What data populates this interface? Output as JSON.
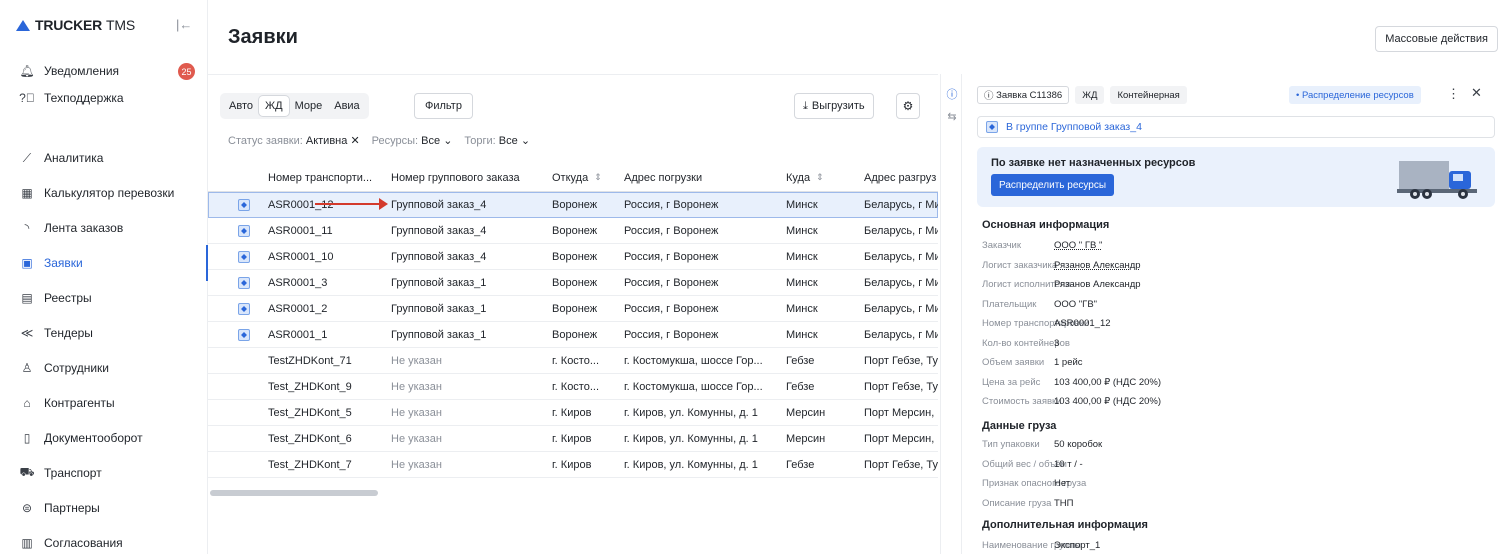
{
  "app": {
    "brand": "TRUCKER",
    "brand_suffix": "TMS"
  },
  "sidebar": {
    "items": [
      {
        "label": "Уведомления",
        "icon": "bell-icon",
        "badge": "25"
      },
      {
        "label": "Техподдержка",
        "icon": "help-icon"
      },
      {
        "label": "Аналитика",
        "icon": "chart-icon"
      },
      {
        "label": "Калькулятор перевозки",
        "icon": "calculator-icon"
      },
      {
        "label": "Лента заказов",
        "icon": "feed-icon"
      },
      {
        "label": "Заявки",
        "icon": "document-icon",
        "active": true
      },
      {
        "label": "Реестры",
        "icon": "registry-icon"
      },
      {
        "label": "Тендеры",
        "icon": "tender-icon"
      },
      {
        "label": "Сотрудники",
        "icon": "user-icon"
      },
      {
        "label": "Контрагенты",
        "icon": "building-icon"
      },
      {
        "label": "Документооборот",
        "icon": "file-icon"
      },
      {
        "label": "Транспорт",
        "icon": "truck-icon"
      },
      {
        "label": "Партнеры",
        "icon": "handshake-icon"
      },
      {
        "label": "Согласования",
        "icon": "approval-icon"
      }
    ]
  },
  "header": {
    "title": "Заявки",
    "mass_actions": "Массовые действия"
  },
  "toolbar": {
    "modes": [
      "Авто",
      "ЖД",
      "Море",
      "Авиа"
    ],
    "active_mode": "ЖД",
    "filter": "Фильтр",
    "export": "Выгрузить"
  },
  "chips": {
    "status_label": "Статус заявки:",
    "status_value": "Активна",
    "resources_label": "Ресурсы:",
    "resources_value": "Все",
    "bids_label": "Торги:",
    "bids_value": "Все"
  },
  "table": {
    "columns": [
      "Номер транспорти...",
      "Номер группового заказа",
      "Откуда",
      "Адрес погрузки",
      "Куда",
      "Адрес разгруз"
    ],
    "rows": [
      {
        "num": "ASR0001_12",
        "group": "Групповой заказ_4",
        "from": "Воронеж",
        "load": "Россия, г Воронеж",
        "to": "Минск",
        "unload": "Беларусь, г Ми",
        "icon": true,
        "selected": true
      },
      {
        "num": "ASR0001_11",
        "group": "Групповой заказ_4",
        "from": "Воронеж",
        "load": "Россия, г Воронеж",
        "to": "Минск",
        "unload": "Беларусь, г Ми",
        "icon": true
      },
      {
        "num": "ASR0001_10",
        "group": "Групповой заказ_4",
        "from": "Воронеж",
        "load": "Россия, г Воронеж",
        "to": "Минск",
        "unload": "Беларусь, г Ми",
        "icon": true
      },
      {
        "num": "ASR0001_3",
        "group": "Групповой заказ_1",
        "from": "Воронеж",
        "load": "Россия, г Воронеж",
        "to": "Минск",
        "unload": "Беларусь, г Ми",
        "icon": true
      },
      {
        "num": "ASR0001_2",
        "group": "Групповой заказ_1",
        "from": "Воронеж",
        "load": "Россия, г Воронеж",
        "to": "Минск",
        "unload": "Беларусь, г Ми",
        "icon": true
      },
      {
        "num": "ASR0001_1",
        "group": "Групповой заказ_1",
        "from": "Воронеж",
        "load": "Россия, г Воронеж",
        "to": "Минск",
        "unload": "Беларусь, г Ми",
        "icon": true
      },
      {
        "num": "TestZHDKont_71",
        "group": "Не указан",
        "from": "г. Косто...",
        "load": "г. Костомукша, шоссе Гор...",
        "to": "Гебзе",
        "unload": "Порт Гебзе, Ту",
        "muted": true
      },
      {
        "num": "Test_ZHDKont_9",
        "group": "Не указан",
        "from": "г. Косто...",
        "load": "г. Костомукша, шоссе Гор...",
        "to": "Гебзе",
        "unload": "Порт Гебзе, Ту",
        "muted": true
      },
      {
        "num": "Test_ZHDKont_5",
        "group": "Не указан",
        "from": "г. Киров",
        "load": "г. Киров, ул. Комунны, д. 1",
        "to": "Мерсин",
        "unload": "Порт Мерсин,",
        "muted": true
      },
      {
        "num": "Test_ZHDKont_6",
        "group": "Не указан",
        "from": "г. Киров",
        "load": "г. Киров, ул. Комунны, д. 1",
        "to": "Мерсин",
        "unload": "Порт Мерсин,",
        "muted": true
      },
      {
        "num": "Test_ZHDKont_7",
        "group": "Не указан",
        "from": "г. Киров",
        "load": "г. Киров, ул. Комунны, д. 1",
        "to": "Гебзе",
        "unload": "Порт Гебзе, Ту",
        "muted": true
      }
    ]
  },
  "panel": {
    "order": "Заявка С11386",
    "type1": "ЖД",
    "type2": "Контейнерная",
    "status": "• Распределение ресурсов",
    "group_link": "В группе Групповой заказ_4",
    "banner_title": "По заявке нет назначенных ресурсов",
    "banner_button": "Распределить ресурсы",
    "main_title": "Основная информация",
    "main": [
      {
        "k": "Заказчик",
        "v": "ООО \" ГВ \""
      },
      {
        "k": "Логист заказчика",
        "v": "Рязанов Александр"
      },
      {
        "k": "Логист исполнителя",
        "v": "Рязанов Александр"
      },
      {
        "k": "Плательщик",
        "v": "ООО \"ГВ\""
      },
      {
        "k": "Номер транспортировки",
        "v": "ASR0001_12"
      },
      {
        "k": "Кол-во контейнеров",
        "v": "3"
      },
      {
        "k": "Объем заявки",
        "v": "1 рейс"
      },
      {
        "k": "Цена за рейс",
        "v": "103 400,00 ₽ (НДС 20%)"
      },
      {
        "k": "Стоимость заявки",
        "v": "103 400,00 ₽ (НДС 20%)"
      }
    ],
    "cargo_title": "Данные груза",
    "cargo": [
      {
        "k": "Тип упаковки",
        "v": "50 коробок"
      },
      {
        "k": "Общий вес / объём",
        "v": "10 т / -"
      },
      {
        "k": "Признак опасного груза",
        "v": "Нет"
      },
      {
        "k": "Описание груза",
        "v": "ТНП"
      }
    ],
    "extra_title": "Дополнительная информация",
    "extra": [
      {
        "k": "Наименование группы",
        "v": "Экспорт_1"
      }
    ]
  },
  "colors": {
    "accent": "#2a66d9",
    "badge": "#e05a4e",
    "arrow": "#d33a2c"
  }
}
